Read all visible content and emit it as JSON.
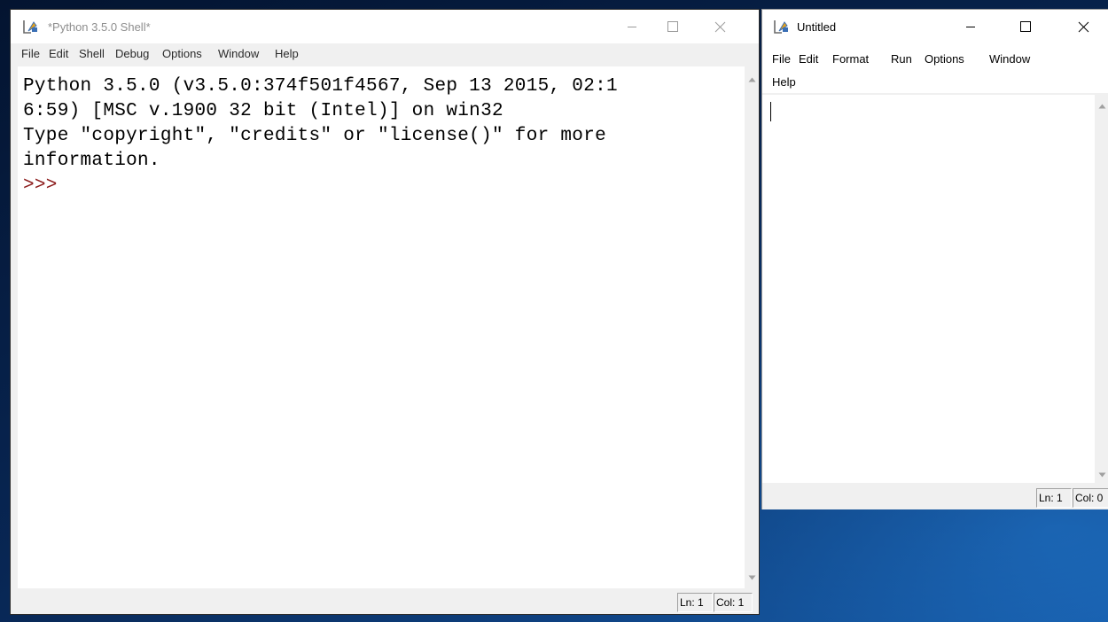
{
  "shell_window": {
    "title": "*Python 3.5.0 Shell*",
    "menu": [
      "File",
      "Edit",
      "Shell",
      "Debug",
      "Options",
      "Window",
      "Help"
    ],
    "lines": [
      "Python 3.5.0 (v3.5.0:374f501f4567, Sep 13 2015, 02:1",
      "6:59) [MSC v.1900 32 bit (Intel)] on win32",
      "Type \"copyright\", \"credits\" or \"license()\" for more",
      "information."
    ],
    "prompt": ">>>",
    "status": {
      "line": "Ln: 1",
      "col": "Col: 1"
    }
  },
  "editor_window": {
    "title": "Untitled",
    "menu": [
      "File",
      "Edit",
      "Format",
      "Run",
      "Options",
      "Window",
      "Help"
    ],
    "status": {
      "line": "Ln: 1",
      "col": "Col: 0"
    }
  },
  "icons": {
    "app": "idle-app-icon",
    "minimize": "minimize-icon",
    "maximize": "maximize-icon",
    "close": "close-icon",
    "scroll_up": "scroll-up-arrow-icon",
    "scroll_down": "scroll-down-arrow-icon"
  },
  "colors": {
    "prompt": "#8b1a1a",
    "inactive_title": "#8e8e8e",
    "desktop": "#0b3d7a"
  }
}
